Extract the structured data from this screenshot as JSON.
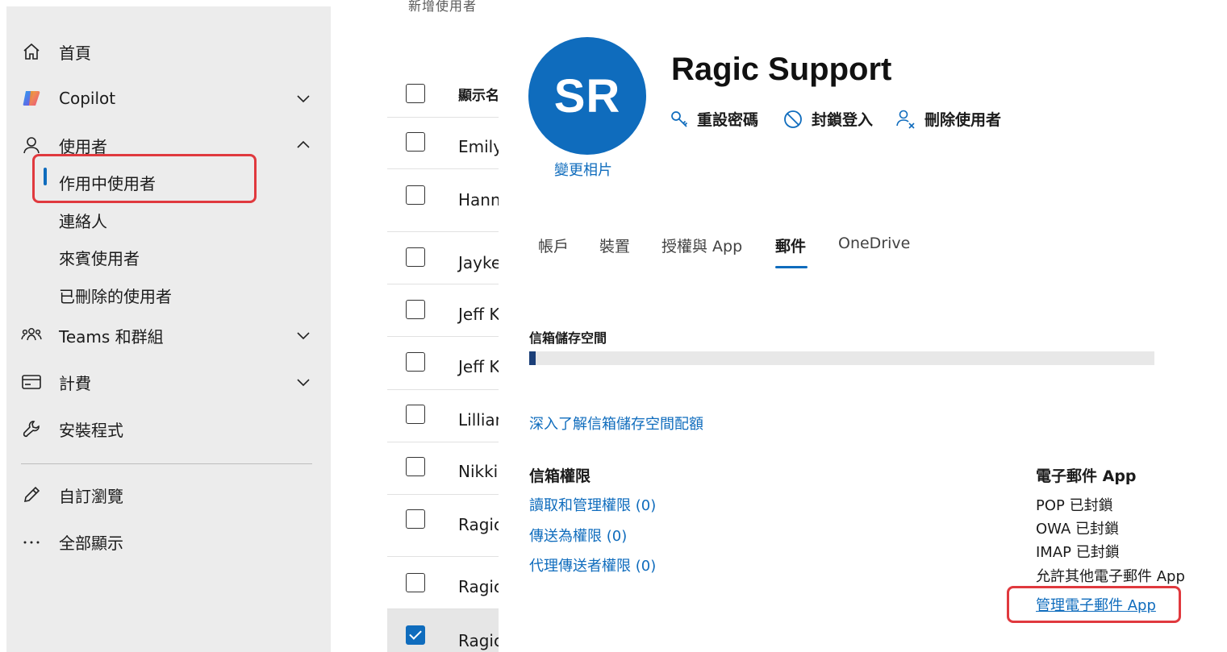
{
  "sidebar": {
    "items": [
      {
        "label": "首頁",
        "icon": "home-icon"
      },
      {
        "label": "Copilot",
        "icon": "copilot-icon",
        "expandable": true
      },
      {
        "label": "使用者",
        "icon": "user-icon",
        "expanded": true
      },
      {
        "label": "Teams 和群組",
        "icon": "teams-icon",
        "expandable": true
      },
      {
        "label": "計費",
        "icon": "billing-icon",
        "expandable": true
      },
      {
        "label": "安裝程式",
        "icon": "wrench-icon"
      },
      {
        "label": "自訂瀏覽",
        "icon": "pencil-icon"
      },
      {
        "label": "全部顯示",
        "icon": "more-icon"
      }
    ],
    "users_subitems": [
      {
        "label": "作用中使用者",
        "active": true
      },
      {
        "label": "連絡人"
      },
      {
        "label": "來賓使用者"
      },
      {
        "label": "已刪除的使用者"
      }
    ]
  },
  "user_list": {
    "top_partial": "新增使用者",
    "header": "顯示名",
    "rows": [
      {
        "name": "Emily",
        "checked": false
      },
      {
        "name": "Hann",
        "checked": false
      },
      {
        "name": "Jayke",
        "checked": false
      },
      {
        "name": "Jeff K",
        "checked": false
      },
      {
        "name": "Jeff K",
        "checked": false
      },
      {
        "name": "Lillian",
        "checked": false
      },
      {
        "name": "Nikki",
        "checked": false
      },
      {
        "name": "Ragic",
        "checked": false
      },
      {
        "name": "Ragic",
        "checked": false
      },
      {
        "name": "Ragic",
        "checked": true
      }
    ]
  },
  "user_detail": {
    "avatar_initials": "SR",
    "change_photo": "變更相片",
    "name": "Ragic Support",
    "actions": [
      {
        "label": "重設密碼",
        "icon": "key-icon"
      },
      {
        "label": "封鎖登入",
        "icon": "block-icon"
      },
      {
        "label": "刪除使用者",
        "icon": "delete-user-icon"
      }
    ],
    "tabs": [
      {
        "label": "帳戶"
      },
      {
        "label": "裝置"
      },
      {
        "label": "授權與 App"
      },
      {
        "label": "郵件",
        "active": true
      },
      {
        "label": "OneDrive"
      }
    ],
    "mailbox_storage": {
      "label": "信箱儲存空間",
      "used_fraction": 0.01,
      "learn_more": "深入了解信箱儲存空間配額"
    },
    "mailbox_permissions": {
      "heading": "信箱權限",
      "links": [
        "讀取和管理權限 (0)",
        "傳送為權限 (0)",
        "代理傳送者權限 (0)"
      ]
    },
    "email_apps": {
      "heading": "電子郵件 App",
      "items": [
        "POP 已封鎖",
        "OWA 已封鎖",
        "IMAP 已封鎖",
        "允許其他電子郵件 App"
      ],
      "manage_link": "管理電子郵件 App"
    }
  },
  "colors": {
    "accent": "#0f6cbd",
    "highlight": "#e0393e",
    "sidebar_bg": "#ececec",
    "storage_fill": "#1b3f78"
  }
}
